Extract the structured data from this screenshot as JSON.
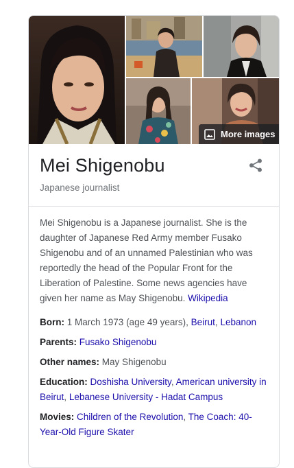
{
  "gallery": {
    "more_images_label": "More images",
    "photos": [
      "portrait-photo",
      "harbor-photo",
      "street-photo",
      "floral-dress-photo",
      "smiling-photo"
    ]
  },
  "entity": {
    "title": "Mei Shigenobu",
    "subtitle": "Japanese journalist"
  },
  "description": {
    "text": "Mei Shigenobu is a Japanese journalist. She is the daughter of Japanese Red Army member Fusako Shigenobu and of an unnamed Palestinian who was reportedly the head of the Popular Front for the Liberation of Palestine. Some news agencies have given her name as May Shigenobu.",
    "source": "Wikipedia"
  },
  "facts": {
    "born": {
      "label": "Born:",
      "value": "1 March 1973 (age 49 years),",
      "link1": "Beirut",
      "sep": ",",
      "link2": "Lebanon"
    },
    "parents": {
      "label": "Parents:",
      "link1": "Fusako Shigenobu"
    },
    "other_names": {
      "label": "Other names:",
      "value": "May Shigenobu"
    },
    "education": {
      "label": "Education:",
      "link1": "Doshisha University",
      "sep1": ",",
      "link2": "American university in Beirut",
      "sep2": ",",
      "link3": "Lebanese University - Hadat Campus"
    },
    "movies": {
      "label": "Movies:",
      "link1": "Children of the Revolution",
      "sep1": ",",
      "link2": "The Coach: 40-Year-Old Figure Skater"
    }
  },
  "icons": {
    "share": "share-icon",
    "images": "image-icon"
  },
  "colors": {
    "link": "#1a0dab",
    "text": "#4d5156",
    "title": "#202124",
    "subtle": "#70757a",
    "border": "#dadce0"
  }
}
